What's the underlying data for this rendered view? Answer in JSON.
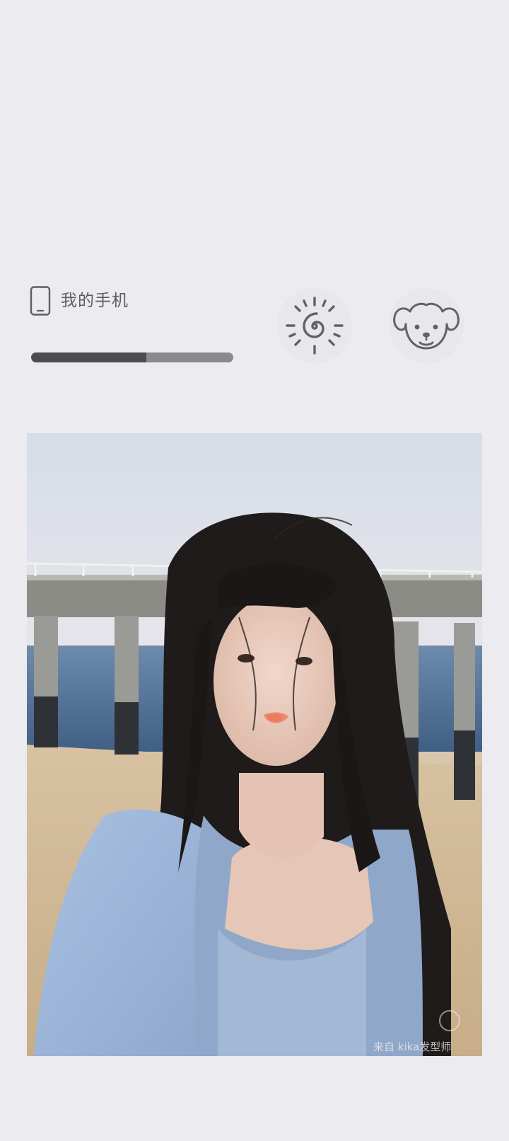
{
  "device": {
    "icon": "phone-icon",
    "name": "我的手机",
    "battery_level": 0.57
  },
  "buttons": [
    {
      "icon": "sun-icon"
    },
    {
      "icon": "puppy-icon"
    }
  ],
  "photo": {
    "watermark": "来自 kika发型师"
  },
  "colors": {
    "background": "#ecebef",
    "text": "#5d5d62",
    "battery_fill": "#4c4b50",
    "battery_track": "#8a898e"
  }
}
